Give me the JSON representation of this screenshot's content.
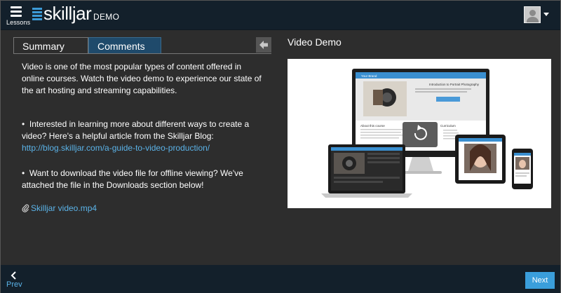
{
  "header": {
    "lessons_label": "Lessons",
    "logo_text": "skilljar",
    "logo_suffix": "DEMO",
    "brand_color": "#3c9ad7"
  },
  "tabs": [
    {
      "label": "Summary",
      "active": true
    },
    {
      "label": "Comments",
      "active": false
    }
  ],
  "summary": {
    "intro": "Video is one of the most popular types of content offered in online courses. Watch the video demo to experience our state of the art hosting and streaming capabilities.",
    "bullet1_text": "Interested in learning more about different ways to create a video? Here's a helpful article from the Skilljar Blog: ",
    "bullet1_link": "http://blog.skilljar.com/a-guide-to-video-production/",
    "bullet2_text": "Want to download the video file for offline viewing? We've attached the file in the Downloads section below!",
    "attachment": "Skilljar video.mp4",
    "bullet_char": "•"
  },
  "video": {
    "title": "Video Demo",
    "thumb_nav_title": "Your Brand",
    "thumb_heading": "Introduction to Portrait Photography",
    "thumb_section": "About this course",
    "thumb_curriculum": "Curriculum"
  },
  "footer": {
    "prev_label": "Prev",
    "next_label": "Next"
  },
  "colors": {
    "topbar": "#13202b",
    "link": "#5bb3e8",
    "active_tab": "#1f4a6b",
    "next_button": "#3a9edb"
  }
}
